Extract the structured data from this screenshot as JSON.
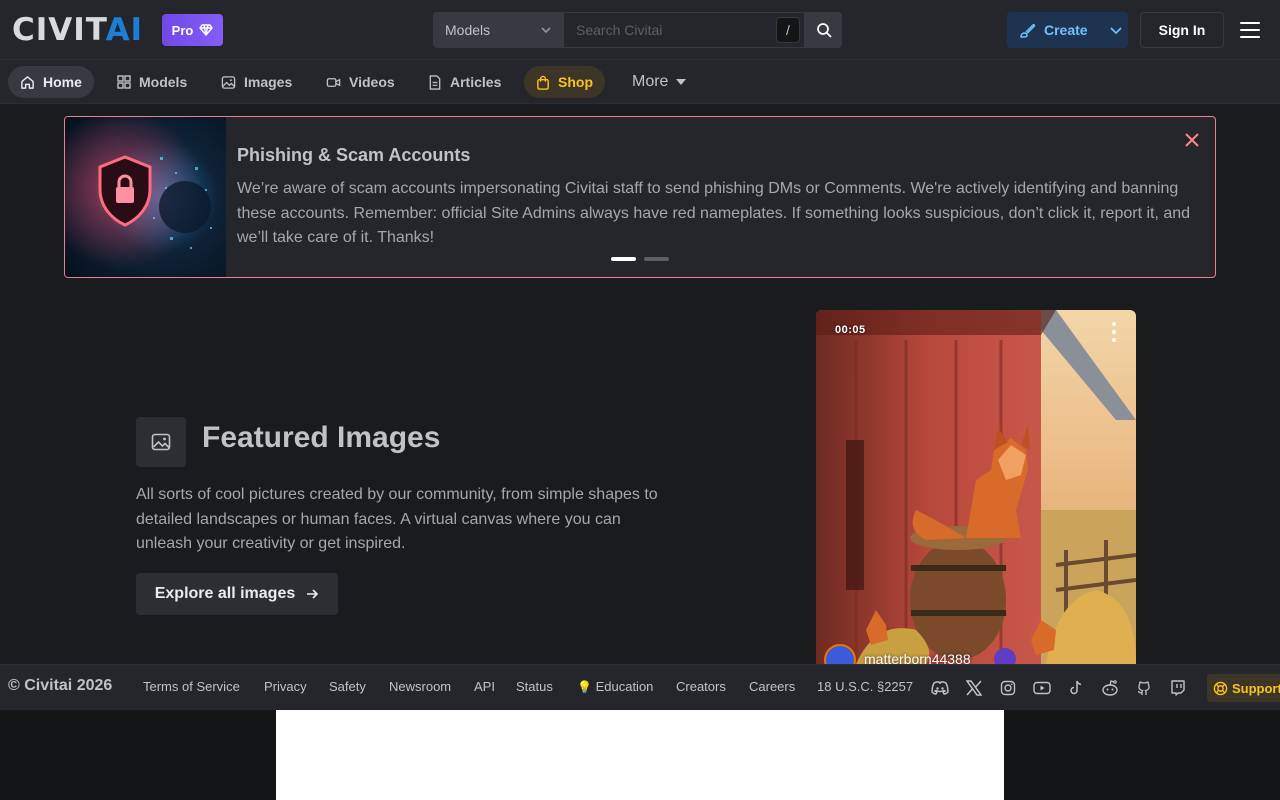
{
  "header": {
    "logo_main": "CIVIT",
    "logo_accent": "AI",
    "pro_label": "Pro",
    "search_scope": "Models",
    "search_placeholder": "Search Civitai",
    "search_shortcut": "/",
    "create_label": "Create",
    "signin_label": "Sign In"
  },
  "nav": {
    "items": [
      {
        "label": "Home",
        "icon": "home-icon"
      },
      {
        "label": "Models",
        "icon": "grid-icon"
      },
      {
        "label": "Images",
        "icon": "photo-icon"
      },
      {
        "label": "Videos",
        "icon": "video-icon"
      },
      {
        "label": "Articles",
        "icon": "file-text-icon"
      },
      {
        "label": "Shop",
        "icon": "shopping-bag-icon"
      }
    ],
    "more_label": "More"
  },
  "announcement": {
    "title": "Phishing & Scam Accounts",
    "body": "We’re aware of scam accounts impersonating Civitai staff to send phishing DMs or Comments. We're actively identifying and banning these accounts. Remember: official Site Admins always have red nameplates. If something looks suspicious, don’t click it, report it, and we’ll take care of it. Thanks!",
    "border_color": "#e8828a"
  },
  "featured": {
    "title": "Featured Images",
    "description": "All sorts of cool pictures created by our community, from simple shapes to detailed landscapes or human faces. A virtual canvas where you can unleash your creativity or get inspired.",
    "button_label": "Explore all images"
  },
  "card": {
    "duration": "00:05",
    "username": "matterborn44388"
  },
  "footer": {
    "copyright": "© Civitai 2026",
    "links": [
      "Terms of Service",
      "Privacy",
      "Safety",
      "Newsroom",
      "API",
      "Status",
      "Education",
      "Creators",
      "Careers",
      "18 U.S.C. §2257"
    ],
    "education_emoji": "💡",
    "support_label": "Support",
    "socials": [
      "discord-icon",
      "x-icon",
      "instagram-icon",
      "youtube-icon",
      "tiktok-icon",
      "reddit-icon",
      "github-icon",
      "twitch-icon"
    ]
  },
  "colors": {
    "accent": "#1c7ed6",
    "shop": "#fcc419",
    "pro": "#7950f2"
  }
}
